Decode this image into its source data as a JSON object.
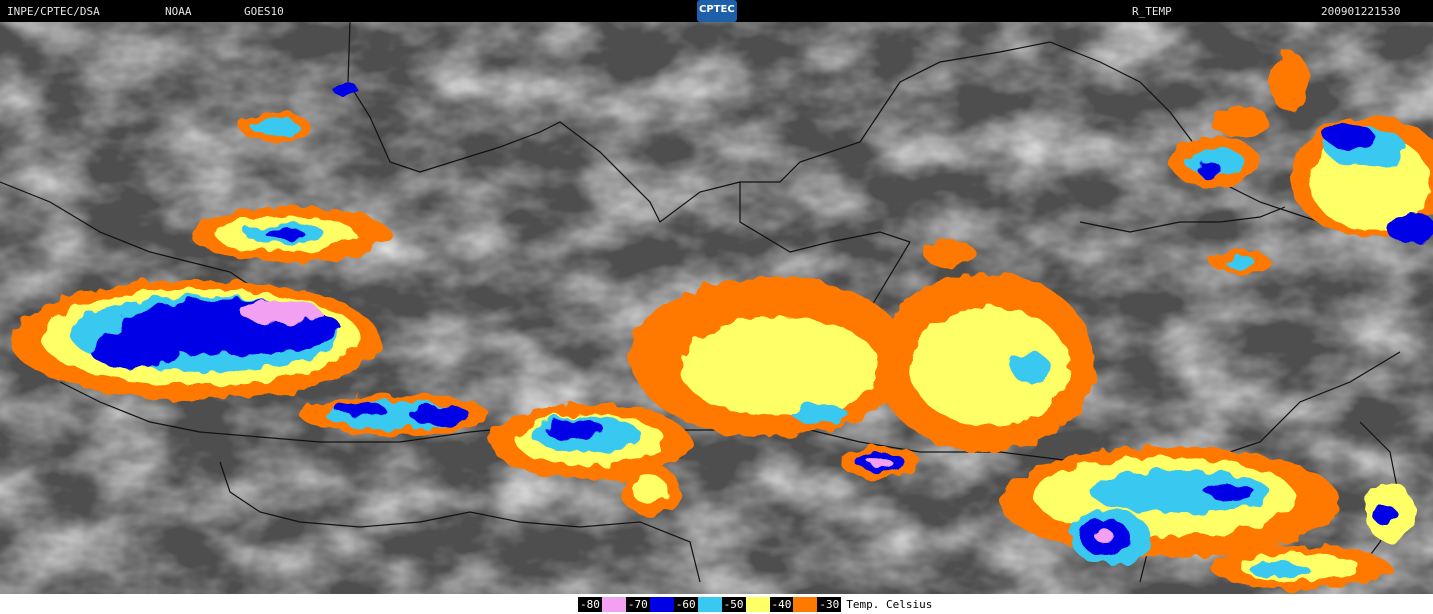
{
  "header": {
    "source": "INPE/CPTEC/DSA",
    "agency": "NOAA",
    "satellite": "GOES10",
    "logo_text": "CPTEC",
    "product": "R_TEMP",
    "timestamp": "200901221530"
  },
  "legend": {
    "items": [
      {
        "label": "-80",
        "color": "#f2a0f2"
      },
      {
        "label": "-70",
        "color": "#0000e6"
      },
      {
        "label": "-60",
        "color": "#38c8f0"
      },
      {
        "label": "-50",
        "color": "#ffff66"
      },
      {
        "label": "-40",
        "color": "#ff7800"
      },
      {
        "label": "-30",
        "color": ""
      }
    ],
    "unit": "Temp. Celsius"
  }
}
